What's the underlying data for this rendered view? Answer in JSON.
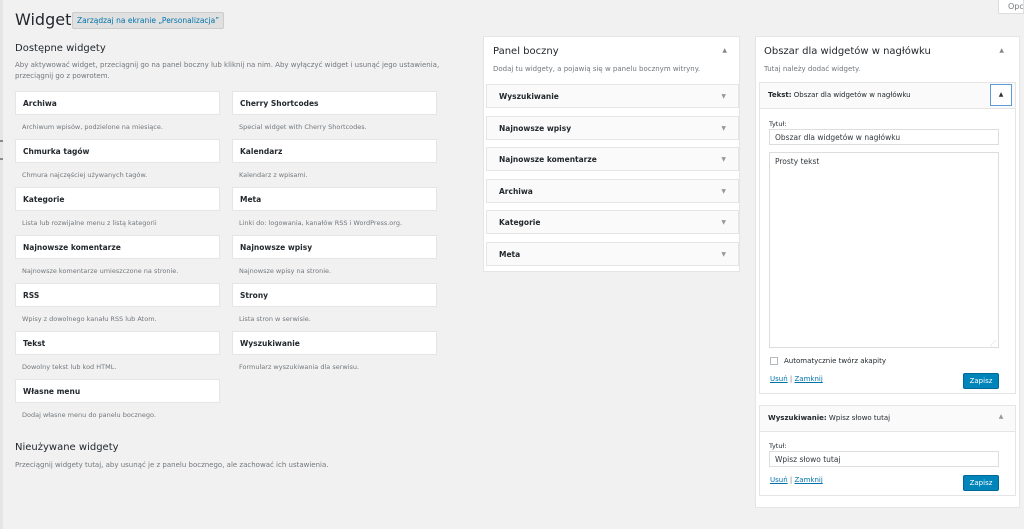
{
  "screen_options": "Opcje",
  "header": {
    "title": "Widgety",
    "manage_link": "Zarządzaj na ekranie „Personalizacja”"
  },
  "available": {
    "title": "Dostępne widgety",
    "description_line1": "Aby aktywować widget, przeciągnij go na panel boczny lub kliknij na nim. Aby wyłączyć widget i usunąć jego ustawienia,",
    "description_line2": "przeciągnij go z powrotem.",
    "widgets": [
      {
        "name": "Archiwa",
        "desc": "Archiwum wpisów, podzielone na miesiące."
      },
      {
        "name": "Cherry Shortcodes",
        "desc": "Special widget with Cherry Shortcodes."
      },
      {
        "name": "Chmurka tagów",
        "desc": "Chmura najczęściej używanych tagów."
      },
      {
        "name": "Kalendarz",
        "desc": "Kalendarz z wpisami."
      },
      {
        "name": "Kategorie",
        "desc": "Lista lub rozwijalne menu z listą kategorii"
      },
      {
        "name": "Meta",
        "desc": "Linki do: logowania, kanałów RSS i WordPress.org."
      },
      {
        "name": "Najnowsze komentarze",
        "desc": "Najnowsze komentarze umieszczone na stronie."
      },
      {
        "name": "Najnowsze wpisy",
        "desc": "Najnowsze wpisy na stronie."
      },
      {
        "name": "RSS",
        "desc": "Wpisy z dowolnego kanału RSS lub Atom."
      },
      {
        "name": "Strony",
        "desc": "Lista stron w serwisie."
      },
      {
        "name": "Tekst",
        "desc": "Dowolny tekst lub kod HTML."
      },
      {
        "name": "Wyszukiwanie",
        "desc": "Formularz wyszukiwania dla serwisu."
      },
      {
        "name": "Własne menu",
        "desc": "Dodaj własne menu do panelu bocznego."
      }
    ]
  },
  "inactive": {
    "title": "Nieużywane widgety",
    "description": "Przeciągnij widgety tutaj, aby usunąć je z panelu bocznego, ale zachować ich ustawienia."
  },
  "sidebar": {
    "title": "Panel boczny",
    "description": "Dodaj tu widgety, a pojawią się w panelu bocznym witryny.",
    "widgets": [
      "Wyszukiwanie",
      "Najnowsze wpisy",
      "Najnowsze komentarze",
      "Archiwa",
      "Kategorie",
      "Meta"
    ]
  },
  "header_area": {
    "title": "Obszar dla widgetów w nagłówku",
    "description": "Tutaj należy dodać widgety.",
    "text_widget": {
      "type": "Tekst:",
      "label": "Obszar dla widgetów w nagłówku",
      "field_label": "Tytuł:",
      "title_value": "Obszar dla widgetów w nagłówku",
      "content": "Prosty tekst",
      "autop_label": "Automatycznie twórz akapity",
      "delete": "Usuń",
      "separator": "|",
      "close": "Zamknij",
      "save": "Zapisz"
    },
    "search_widget": {
      "type": "Wyszukiwanie:",
      "label": "Wpisz słowo tutaj",
      "field_label": "Tytuł:",
      "title_value": "Wpisz słowo tutaj",
      "delete": "Usuń",
      "separator": "|",
      "close": "Zamknij",
      "save": "Zapisz"
    }
  }
}
